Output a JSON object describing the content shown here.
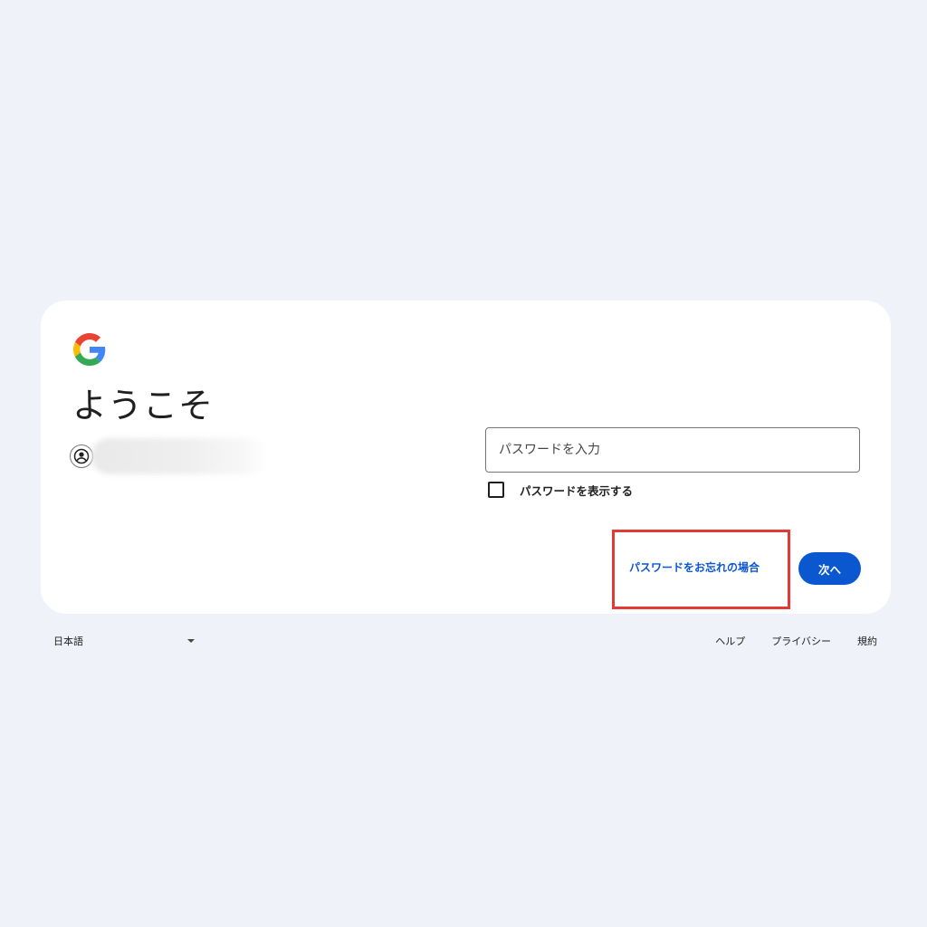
{
  "card": {
    "heading": "ようこそ",
    "logo_icon": "google-g-icon",
    "account_icon": "account-circle-icon",
    "password_field": {
      "placeholder": "パスワードを入力",
      "value": ""
    },
    "show_password_label": "パスワードを表示する",
    "forgot_password_label": "パスワードをお忘れの場合",
    "next_button_label": "次へ"
  },
  "footer": {
    "language": "日本語",
    "links": [
      "ヘルプ",
      "プライバシー",
      "規約"
    ]
  },
  "colors": {
    "background": "#eff3f9",
    "card": "#ffffff",
    "accent": "#0b57d0",
    "highlight_box": "#e53935"
  }
}
